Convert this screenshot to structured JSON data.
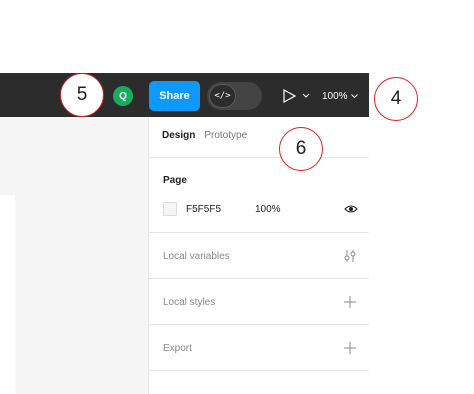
{
  "toolbar": {
    "avatar_initial": "Q",
    "share_label": "Share",
    "dev_mode_glyph": "</>",
    "present_icon": "play-icon",
    "zoom": "100%"
  },
  "panel": {
    "tabs": [
      {
        "label": "Design",
        "active": true
      },
      {
        "label": "Prototype",
        "active": false
      }
    ],
    "page_section": {
      "title": "Page",
      "fill_hex": "F5F5F5",
      "fill_opacity": "100%"
    },
    "rows": [
      {
        "label": "Local variables",
        "icon": "variables-icon"
      },
      {
        "label": "Local styles",
        "icon": "plus-icon"
      },
      {
        "label": "Export",
        "icon": "plus-icon"
      }
    ]
  },
  "callouts": [
    "5",
    "4",
    "6"
  ],
  "colors": {
    "toolbar": "#2c2c2c",
    "share": "#0d99ff",
    "avatar": "#14ae5c",
    "callout_border": "#e0201b",
    "canvas": "#f5f5f5"
  }
}
